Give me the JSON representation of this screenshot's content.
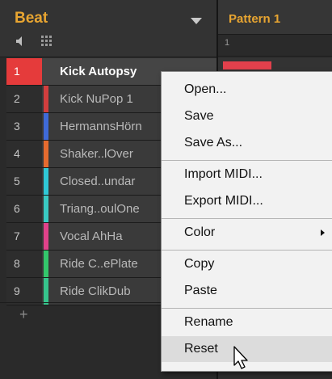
{
  "group": {
    "title": "Beat",
    "icons": [
      "speaker-icon",
      "grid-icon",
      "chevron-down-icon",
      "plus-icon"
    ]
  },
  "sounds": [
    {
      "num": "1",
      "name": "Kick Autopsy",
      "color": "#e53b3b",
      "selected": true
    },
    {
      "num": "2",
      "name": "Kick NuPop 1",
      "color": "#d23e3e"
    },
    {
      "num": "3",
      "name": "HermannsHörn",
      "color": "#3f6ad8"
    },
    {
      "num": "4",
      "name": "Shaker..lOver",
      "color": "#e56b2f"
    },
    {
      "num": "5",
      "name": "Closed..undar",
      "color": "#2fc8d6"
    },
    {
      "num": "6",
      "name": "Triang..oulOne",
      "color": "#39c9c2"
    },
    {
      "num": "7",
      "name": "Vocal AhHa",
      "color": "#e0428a"
    },
    {
      "num": "8",
      "name": "Ride C..ePlate",
      "color": "#33c76b"
    },
    {
      "num": "9",
      "name": "Ride ClikDub",
      "color": "#36c48c"
    }
  ],
  "add_sound": "+",
  "pattern": {
    "title": "Pattern 1",
    "step_label": "1"
  },
  "context_menu": {
    "open": "Open...",
    "save": "Save",
    "save_as": "Save As...",
    "import_midi": "Import MIDI...",
    "export_midi": "Export MIDI...",
    "color": "Color",
    "copy": "Copy",
    "paste": "Paste",
    "rename": "Rename",
    "reset": "Reset",
    "hovered_item": "Reset"
  },
  "colors": {
    "accent": "#e8a531",
    "selected_num_bg": "#e53b3b",
    "menu_bg": "#f2f2f2"
  }
}
